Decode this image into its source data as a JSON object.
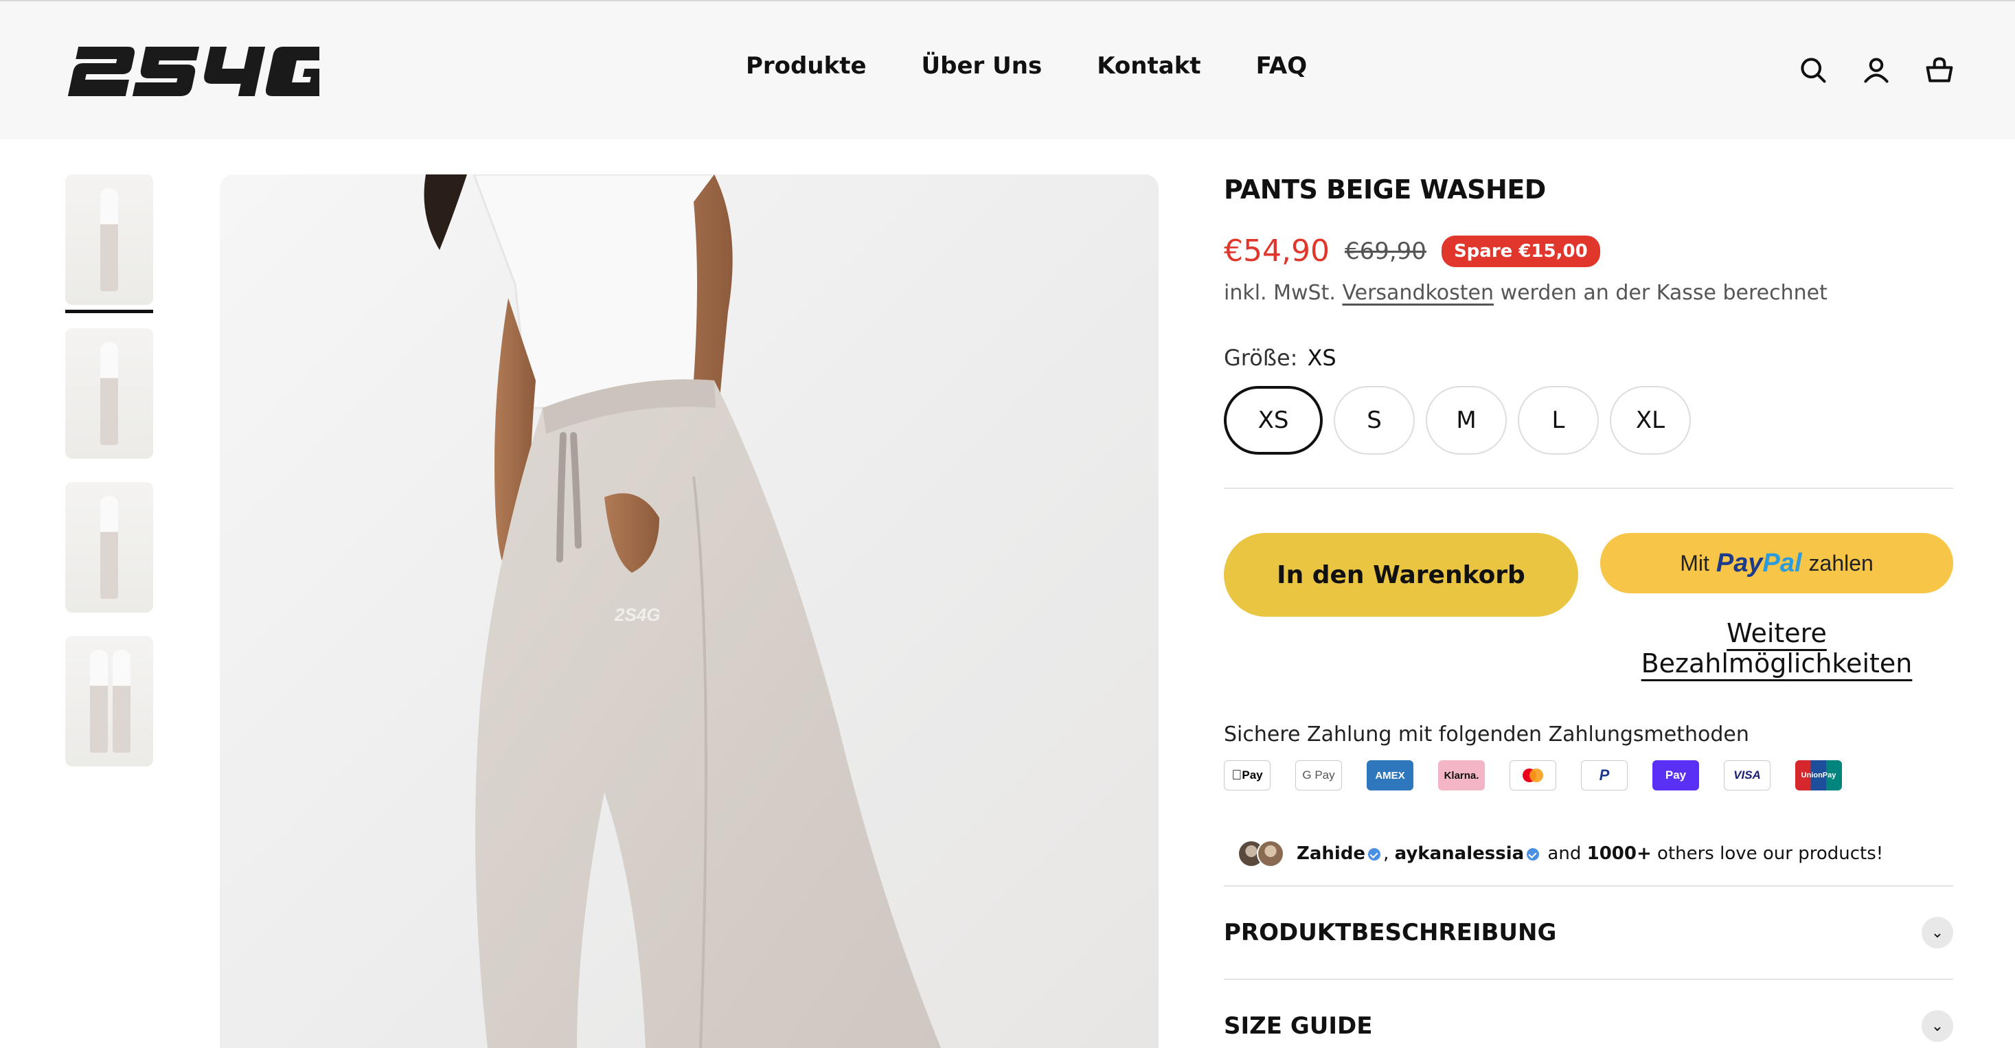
{
  "header": {
    "logo_text": "2S4G",
    "nav": [
      "Produkte",
      "Über Uns",
      "Kontakt",
      "FAQ"
    ],
    "icons": [
      "search-icon",
      "account-icon",
      "cart-icon"
    ]
  },
  "gallery": {
    "thumbnail_count": 4,
    "active_thumbnail": 1
  },
  "product": {
    "title": "PANTS BEIGE WASHED",
    "price": "€54,90",
    "compare_price": "€69,90",
    "save_badge": "Spare €15,00",
    "tax_prefix": "inkl. MwSt.",
    "tax_link": "Versandkosten",
    "tax_suffix": "werden an der Kasse berechnet",
    "size_label": "Größe:",
    "size_selected": "XS",
    "sizes": [
      "XS",
      "S",
      "M",
      "L",
      "XL"
    ],
    "add_to_cart": "In den Warenkorb",
    "paypal_prefix": "Mit",
    "paypal_brand_1": "Pay",
    "paypal_brand_2": "Pal",
    "paypal_suffix": "zahlen",
    "more_payment": "Weitere Bezahlmöglichkeiten",
    "secure_payment_title": "Sichere Zahlung mit folgenden Zahlungsmethoden",
    "payment_methods": [
      "Pay",
      "G Pay",
      "AMEX",
      "Klarna.",
      "",
      "P",
      "Pay",
      "VISA",
      "UnionPay"
    ],
    "social_user_1": "Zahide",
    "social_user_2": "aykanalessia",
    "social_mid": "and",
    "social_count": "1000+",
    "social_suffix": "others love our products!",
    "accordion": [
      "PRODUKTBESCHREIBUNG",
      "SIZE GUIDE"
    ]
  },
  "colors": {
    "accent_red": "#e0362c",
    "cart_button": "#e9c542",
    "paypal_button": "#f7c547"
  }
}
